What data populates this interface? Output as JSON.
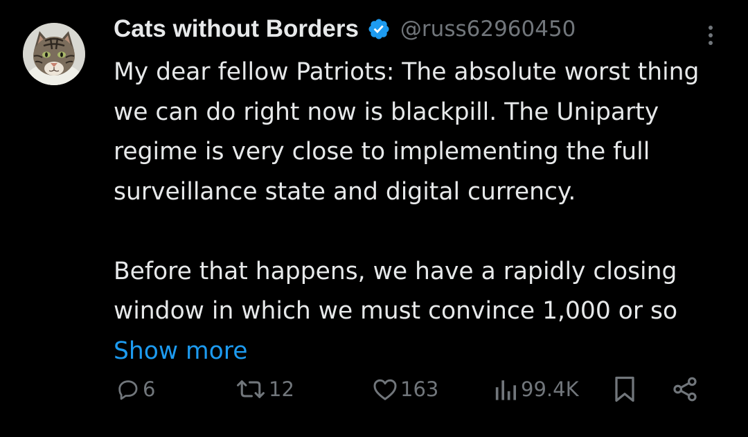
{
  "author": {
    "display_name": "Cats without Borders",
    "handle": "@russ62960450",
    "verified": true,
    "avatar_icon": "cat-avatar-icon"
  },
  "tweet": {
    "paragraphs": [
      "My dear fellow Patriots: The absolute worst thing we can do right now is blackpill. The Uniparty regime is very close to implementing the full surveillance state and digital currency.",
      "Before that happens, we have a rapidly closing window in which we must convince 1,000 or so"
    ],
    "show_more_label": "Show more"
  },
  "actions": {
    "replies": "6",
    "retweets": "12",
    "likes": "163",
    "views": "99.4K"
  },
  "colors": {
    "background": "#000000",
    "text": "#e7e9ea",
    "muted": "#71767b",
    "accent": "#1d9bf0"
  }
}
